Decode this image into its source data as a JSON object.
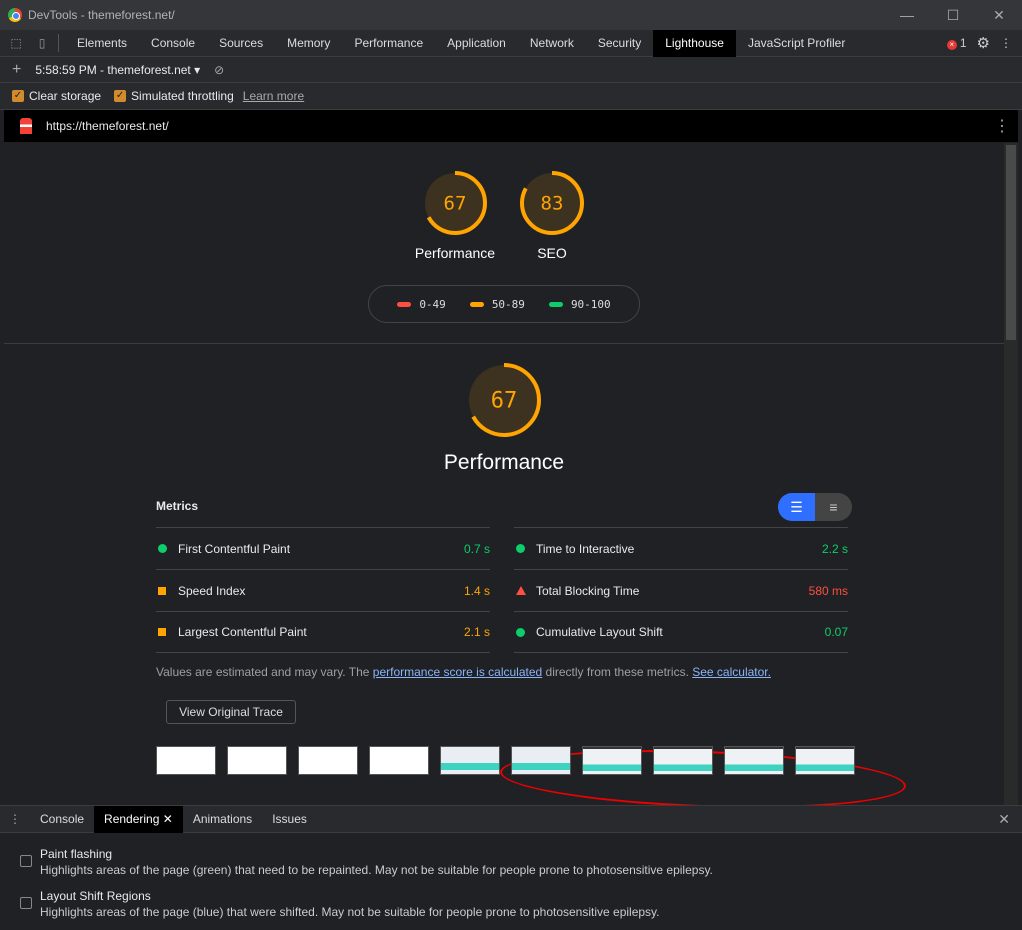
{
  "window": {
    "title": "DevTools - themeforest.net/"
  },
  "tabs": [
    "Elements",
    "Console",
    "Sources",
    "Memory",
    "Performance",
    "Application",
    "Network",
    "Security",
    "Lighthouse",
    "JavaScript Profiler"
  ],
  "active_tab": "Lighthouse",
  "error_count": "1",
  "report_selector": "5:58:59 PM - themeforest.net",
  "options": {
    "clear_storage": "Clear storage",
    "throttling": "Simulated throttling",
    "learn_more": "Learn more"
  },
  "url": "https://themeforest.net/",
  "summary": [
    {
      "label": "Performance",
      "score": 67
    },
    {
      "label": "SEO",
      "score": 83
    }
  ],
  "legend": [
    {
      "range": "0-49",
      "color": "#ff4e42"
    },
    {
      "range": "50-89",
      "color": "#ffa400"
    },
    {
      "range": "90-100",
      "color": "#0cce6b"
    }
  ],
  "category": {
    "label": "Performance",
    "score": 67
  },
  "metrics_title": "Metrics",
  "metrics_left": [
    {
      "name": "First Contentful Paint",
      "value": "0.7 s",
      "status": "pass"
    },
    {
      "name": "Speed Index",
      "value": "1.4 s",
      "status": "average"
    },
    {
      "name": "Largest Contentful Paint",
      "value": "2.1 s",
      "status": "average"
    }
  ],
  "metrics_right": [
    {
      "name": "Time to Interactive",
      "value": "2.2 s",
      "status": "pass"
    },
    {
      "name": "Total Blocking Time",
      "value": "580 ms",
      "status": "fail"
    },
    {
      "name": "Cumulative Layout Shift",
      "value": "0.07",
      "status": "pass"
    }
  ],
  "note": {
    "pre": "Values are estimated and may vary. The ",
    "link1": "performance score is calculated",
    "mid": " directly from these metrics. ",
    "link2": "See calculator."
  },
  "trace_button": "View Original Trace",
  "drawer": {
    "tabs": [
      "Console",
      "Rendering",
      "Animations",
      "Issues"
    ],
    "active": "Rendering",
    "options": [
      {
        "title": "Paint flashing",
        "desc": "Highlights areas of the page (green) that need to be repainted. May not be suitable for people prone to photosensitive epilepsy."
      },
      {
        "title": "Layout Shift Regions",
        "desc": "Highlights areas of the page (blue) that were shifted. May not be suitable for people prone to photosensitive epilepsy."
      }
    ]
  },
  "colors": {
    "pass": "#0cce6b",
    "average": "#ffa400",
    "fail": "#ff4e42"
  }
}
